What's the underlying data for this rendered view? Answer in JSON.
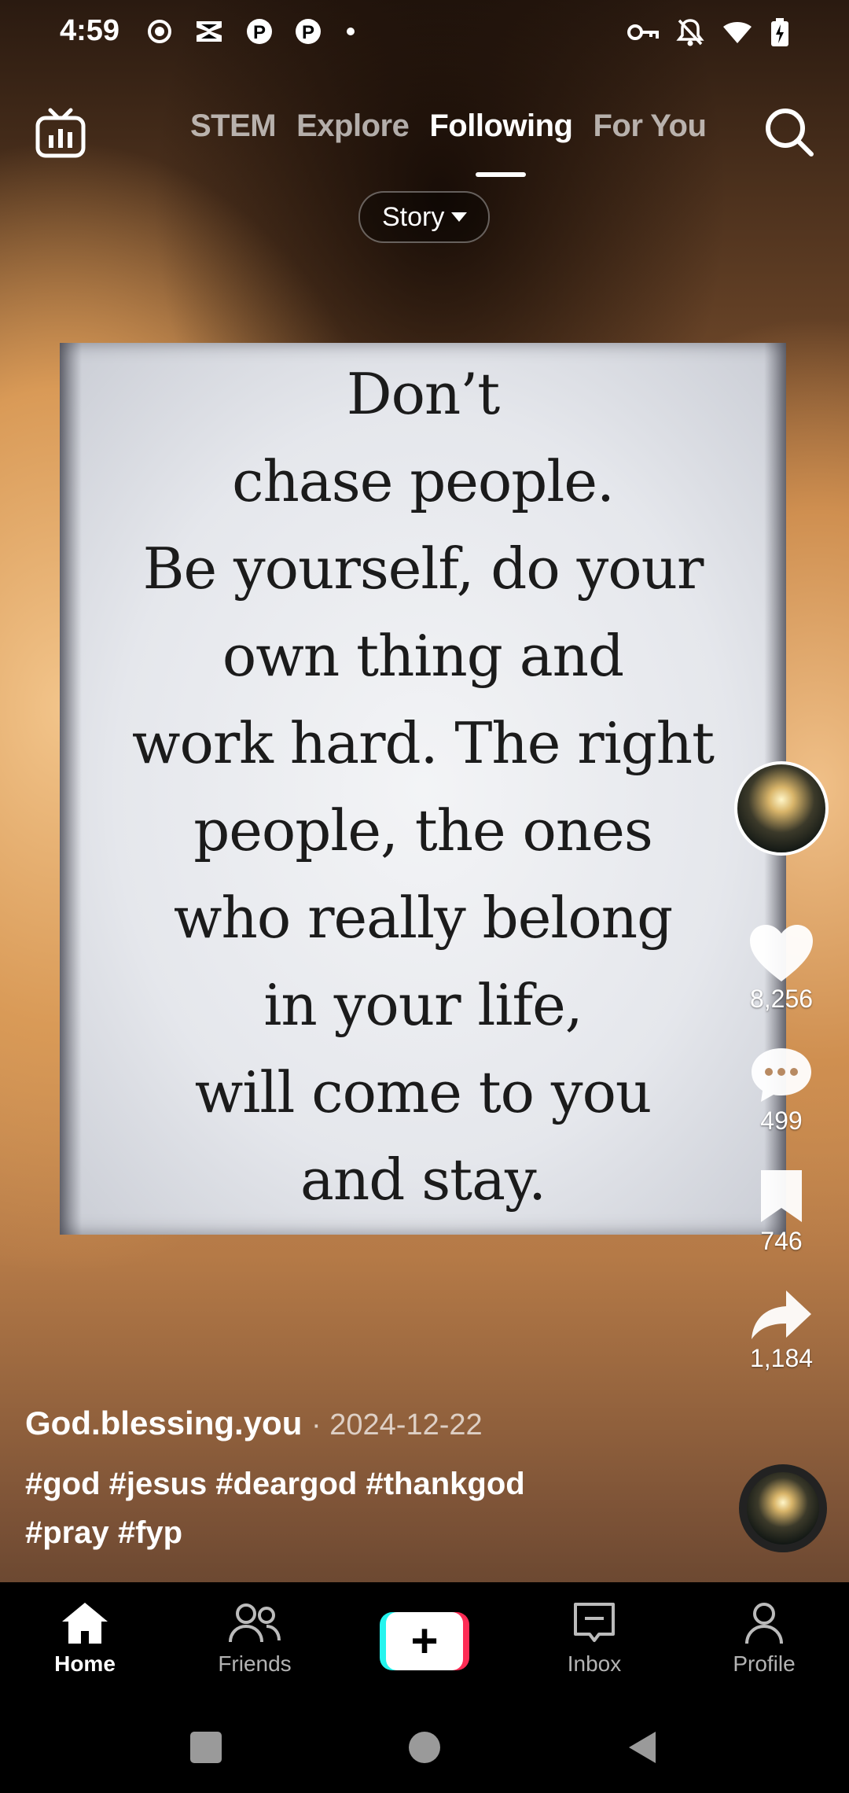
{
  "status_bar": {
    "time": "4:59",
    "icons_left": [
      "record-icon",
      "capcut-icon",
      "pinterest-icon",
      "pinterest-icon",
      "dot-icon"
    ],
    "icons_right": [
      "vpn-key-icon",
      "notifications-off-icon",
      "wifi-icon",
      "battery-charging-icon"
    ]
  },
  "top_nav": {
    "tabs": [
      {
        "label": "STEM",
        "active": false
      },
      {
        "label": "Explore",
        "active": false
      },
      {
        "label": "Following",
        "active": true
      },
      {
        "label": "For You",
        "active": false
      }
    ],
    "filter_label": "Story"
  },
  "video": {
    "quote_text": "Don’t\nchase people.\nBe yourself, do your\nown thing and\nwork hard. The right\npeople, the ones\nwho really belong\nin your life,\nwill come to you\nand stay."
  },
  "actions": {
    "likes": "8,256",
    "comments": "499",
    "saves": "746",
    "shares": "1,184"
  },
  "caption": {
    "author": "God.blessing.you",
    "date": "· 2024-12-22",
    "hashtags": "#god #jesus #deargod #thankgod #pray #fyp"
  },
  "bottom_nav": {
    "items": [
      {
        "label": "Home",
        "active": true
      },
      {
        "label": "Friends",
        "active": false
      },
      {
        "label": "",
        "active": false
      },
      {
        "label": "Inbox",
        "active": false
      },
      {
        "label": "Profile",
        "active": false
      }
    ],
    "create_symbol": "+"
  },
  "colors": {
    "accent_cyan": "#25f4ee",
    "accent_red": "#fe2c55",
    "text": "#ffffff"
  }
}
